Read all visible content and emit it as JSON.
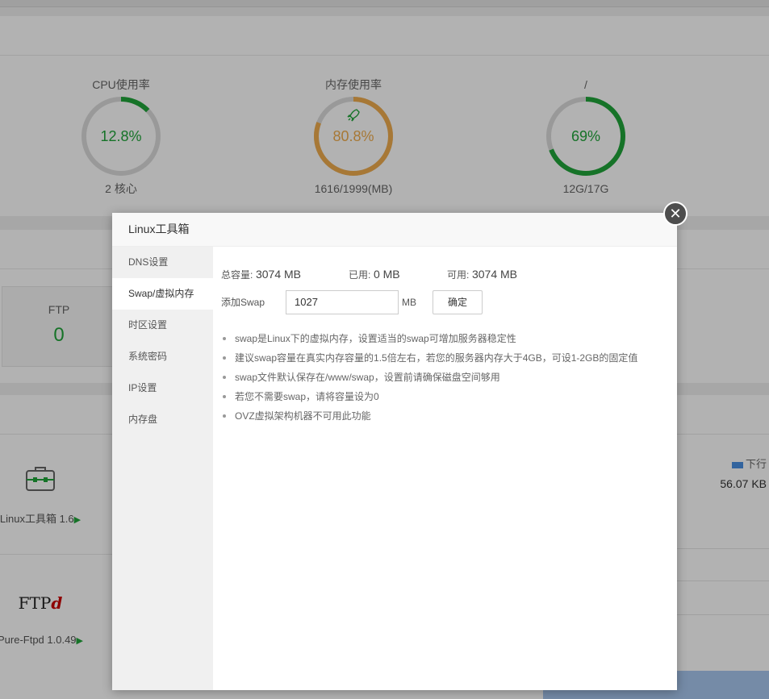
{
  "stats": {
    "cpu": {
      "title": "CPU使用率",
      "value": "12.8%",
      "percent": 12.8,
      "sub": "2 核心",
      "color": "#20a53a"
    },
    "memory": {
      "title": "内存使用率",
      "value": "80.8%",
      "percent": 80.8,
      "sub": "1616/1999(MB)",
      "color": "#f0ad4e",
      "icon": "rocket-icon"
    },
    "disk": {
      "title": "/",
      "value": "69%",
      "percent": 69,
      "sub": "12G/17G",
      "color": "#20a53a"
    }
  },
  "ftp_box": {
    "label": "FTP",
    "count": "0"
  },
  "software": [
    {
      "name": "Linux工具箱 1.6",
      "icon": "toolbox-icon"
    },
    {
      "name": "Pure-Ftpd 1.0.49",
      "logo_text": "FTP",
      "logo_accent": "d"
    }
  ],
  "network": {
    "legend": "下行",
    "value": "56.07 KB"
  },
  "modal": {
    "title": "Linux工具箱",
    "menu": [
      {
        "label": "DNS设置",
        "active": false
      },
      {
        "label": "Swap/虚拟内存",
        "active": true
      },
      {
        "label": "时区设置",
        "active": false
      },
      {
        "label": "系统密码",
        "active": false
      },
      {
        "label": "IP设置",
        "active": false
      },
      {
        "label": "内存盘",
        "active": false
      }
    ],
    "summary": {
      "total_label": "总容量:",
      "total_value": "3074 MB",
      "used_label": "已用:",
      "used_value": "0 MB",
      "free_label": "可用:",
      "free_value": "3074 MB"
    },
    "form": {
      "label": "添加Swap",
      "value": "1027",
      "unit": "MB",
      "submit": "确定"
    },
    "tips": [
      "swap是Linux下的虚拟内存，设置适当的swap可增加服务器稳定性",
      "建议swap容量在真实内存容量的1.5倍左右，若您的服务器内存大于4GB，可设1-2GB的固定值",
      "swap文件默认保存在/www/swap，设置前请确保磁盘空间够用",
      "若您不需要swap，请将容量设为0",
      "OVZ虚拟架构机器不可用此功能"
    ],
    "close_icon": "close-icon"
  }
}
